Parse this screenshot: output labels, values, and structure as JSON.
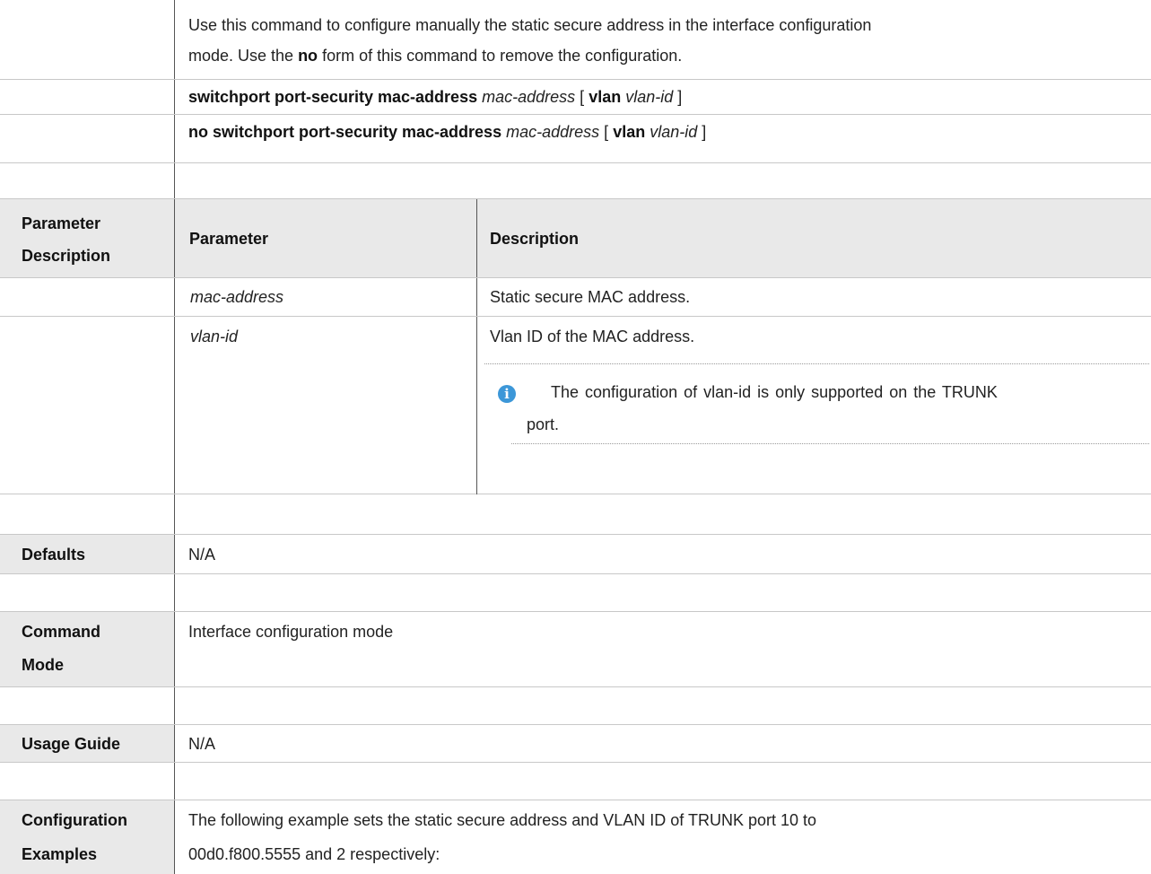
{
  "intro": {
    "line1": "Use this command to configure manually the static secure address in the interface configuration",
    "line2_a": "mode. Use the ",
    "line2_no": "no",
    "line2_b": " form of this command to remove the configuration."
  },
  "syntax": {
    "cmd": "switchport port-security mac-address",
    "no_cmd": "no switchport port-security mac-address",
    "arg_mac": "mac-address",
    "open_bracket": "[",
    "kw_vlan": "vlan",
    "arg_vlan": "vlan-id",
    "close_bracket": "]"
  },
  "param_section": {
    "label_1": "Parameter",
    "label_2": "Description",
    "header_param": "Parameter",
    "header_desc": "Description",
    "rows": [
      {
        "param": "mac-address",
        "desc": "Static secure MAC address."
      },
      {
        "param": "vlan-id",
        "desc": "Vlan ID of the MAC address."
      }
    ],
    "note_line1": "The configuration of vlan-id is only supported on the TRUNK",
    "note_line2": "port.",
    "note_icon": "info-icon"
  },
  "defaults": {
    "label": "Defaults",
    "value": "N/A"
  },
  "command_mode": {
    "label_1": "Command",
    "label_2": "Mode",
    "value": "Interface configuration mode"
  },
  "usage_guide": {
    "label": "Usage Guide",
    "value": "N/A"
  },
  "config_examples": {
    "label_1": "Configuration",
    "label_2": "Examples",
    "line1": "The following example sets the static secure address and VLAN ID of TRUNK port 10 to",
    "line2": "00d0.f800.5555 and 2 respectively:"
  }
}
